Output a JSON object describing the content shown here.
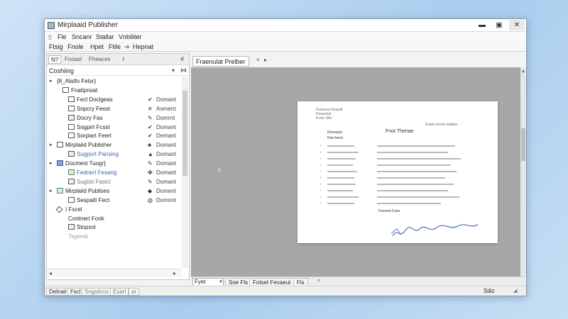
{
  "window": {
    "title": "Mirplaaid Publisher"
  },
  "menu": [
    "Fle",
    "Sncanr",
    "Stallar",
    "Vnbiliter"
  ],
  "toolbar": {
    "items": [
      "Ftsig",
      "Fnole",
      "Hpet",
      "Ftile"
    ],
    "arrow_item": "Hepnat"
  },
  "left_panel": {
    "tabs": [
      "N?",
      "Fooasl",
      "Fheaces"
    ],
    "tab_marker": "ł",
    "collapse": "«",
    "header": "Coshiing",
    "tree": [
      {
        "label": "{8_Alatfo Fetsr}",
        "indent": 0,
        "caret": "▸",
        "icon": "none",
        "style": "normal"
      },
      {
        "label": "Fnatipnsat",
        "indent": 1,
        "caret": "",
        "icon": "box",
        "style": "normal"
      },
      {
        "label": "Fecl Doclgeas",
        "indent": 2,
        "caret": "",
        "icon": "box",
        "style": "normal",
        "status_icon": "✔",
        "status": "Domant"
      },
      {
        "label": "Sopcry Feost",
        "indent": 2,
        "caret": "",
        "icon": "box",
        "style": "normal",
        "status_icon": "✕",
        "status": "Aoment"
      },
      {
        "label": "Docry Fas",
        "indent": 2,
        "caret": "",
        "icon": "doc",
        "style": "normal",
        "status_icon": "✎",
        "status": "Domrnt"
      },
      {
        "label": "Sogpirt Fcsst",
        "indent": 2,
        "caret": "",
        "icon": "box",
        "style": "normal",
        "status_icon": "✔",
        "status": "Domant"
      },
      {
        "label": "Sorpiart Feert",
        "indent": 2,
        "caret": "",
        "icon": "box",
        "style": "normal",
        "status_icon": "✔",
        "status": "Demant"
      },
      {
        "label": "Mirplaiid Publisher",
        "indent": 0,
        "caret": "▸",
        "icon": "box",
        "style": "normal",
        "status_icon": "♣",
        "status": "Domant"
      },
      {
        "label": "Sugport Pansing",
        "indent": 2,
        "caret": "",
        "icon": "doc",
        "style": "blue",
        "status_icon": "▲",
        "status": "Domant"
      },
      {
        "label": "Docmeni Tuogr}",
        "indent": 0,
        "caret": "▸",
        "icon": "blue",
        "style": "normal",
        "status_icon": "✎",
        "status": "Domant"
      },
      {
        "label": "Fednert Fesang",
        "indent": 2,
        "caret": "",
        "icon": "green",
        "style": "blue",
        "status_icon": "✤",
        "status": "Domant"
      },
      {
        "label": "Sugtist Fasict",
        "indent": 2,
        "caret": "",
        "icon": "doc",
        "style": "faded",
        "status_icon": "✎",
        "status": "Domant"
      },
      {
        "label": "Mirplaiid Publises",
        "indent": 0,
        "caret": "▸",
        "icon": "green",
        "style": "normal",
        "status_icon": "◆",
        "status": "Doment"
      },
      {
        "label": "Sespaiti Fect",
        "indent": 2,
        "caret": "",
        "icon": "box",
        "style": "normal",
        "status_icon": "◍",
        "status": "Domnnt"
      },
      {
        "label": "ï Fscel",
        "indent": 0,
        "caret": "",
        "icon": "diamond",
        "style": "normal"
      },
      {
        "label": "Contnert Fonk",
        "indent": 2,
        "caret": "",
        "icon": "none",
        "style": "normal"
      },
      {
        "label": "Stopsst",
        "indent": 2,
        "caret": "",
        "icon": "doc",
        "style": "normal"
      },
      {
        "label": "Tsgeeat",
        "indent": 2,
        "caret": "",
        "icon": "none",
        "style": "faint"
      }
    ]
  },
  "preview": {
    "tab": "Fraenulat Prelber",
    "tab_close": "×",
    "tab_arrow": "▸",
    "nav_prev": "‹",
    "nav_next": "›",
    "document": {
      "header_lines": [
        "Fosonca  Fonpolt",
        "Pearsrest",
        "Feon:  Mer"
      ],
      "header_right": "Evpoc   lorore   luetdos",
      "title": "Fnot Theriae",
      "subheads": [
        "Rimesgst",
        "Rstr fernd",
        "Fesoest Fase"
      ],
      "signature": "signature"
    }
  },
  "preview_bottom": {
    "combo": "Fyet",
    "buttons": [
      "Soe Fls",
      "Fotset Fevaeut",
      "Fis"
    ],
    "close": "×"
  },
  "statusbar": {
    "tabs": [
      "Delnair",
      "Fscl",
      "Sngsilcos",
      "Esarl",
      "ar"
    ],
    "right": "Sdiz",
    "grip": "◢"
  },
  "icons": {
    "app": "publisher-app-icon",
    "minimize": "minimize-icon",
    "maximize": "maximize-icon",
    "close": "close-icon"
  },
  "colors": {
    "accent_blue": "#3a6ab0",
    "preview_bg": "#a7a7a7",
    "desktop_bg": "#a9cdee"
  }
}
